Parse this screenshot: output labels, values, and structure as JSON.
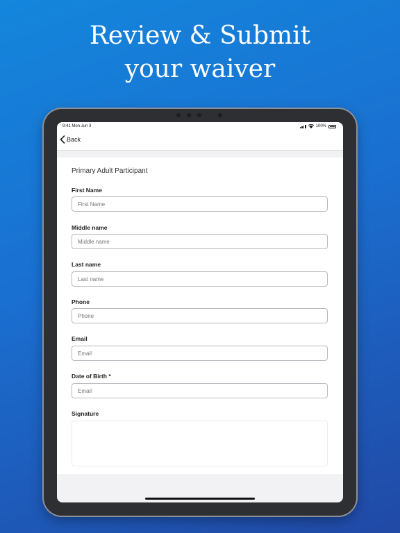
{
  "headline": {
    "line1": "Review & Submit",
    "line2": "your waiver"
  },
  "status_bar": {
    "time": "9:41 Mon Jun 3",
    "battery": "100%"
  },
  "nav": {
    "back_label": "Back"
  },
  "form": {
    "section_title": "Primary Adult Participant",
    "fields": [
      {
        "label": "First Name",
        "placeholder": "First Name"
      },
      {
        "label": "Middle name",
        "placeholder": "Middle name"
      },
      {
        "label": "Last name",
        "placeholder": "Last name"
      },
      {
        "label": "Phone",
        "placeholder": "Phone"
      },
      {
        "label": "Email",
        "placeholder": "Email"
      },
      {
        "label": "Date of Birth *",
        "placeholder": "Email"
      }
    ],
    "signature_label": "Signature"
  }
}
